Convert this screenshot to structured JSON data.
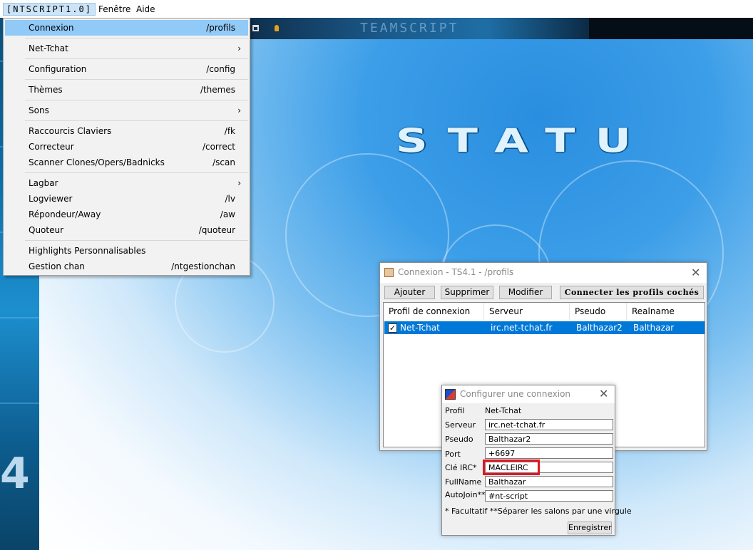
{
  "menubar": {
    "items": [
      {
        "label": "[NTSCRIPT1.0]"
      },
      {
        "label": "Fenêtre"
      },
      {
        "label": "Aide"
      }
    ]
  },
  "banner": {
    "title": "TEAMSCRIPT"
  },
  "logo": {
    "text": "STATU"
  },
  "left_deco": {
    "text": "4"
  },
  "dropdown": {
    "items": [
      {
        "label": "Connexion",
        "shortcut": "/profils",
        "active": true
      },
      {
        "label": "Net-Tchat",
        "submenu": true
      },
      {
        "label": "Configuration",
        "shortcut": "/config"
      },
      {
        "label": "Thèmes",
        "shortcut": "/themes"
      },
      {
        "label": "Sons",
        "submenu": true
      },
      {
        "label": "Raccourcis Claviers",
        "shortcut": "/fk"
      },
      {
        "label": "Correcteur",
        "shortcut": "/correct"
      },
      {
        "label": "Scanner Clones/Opers/Badnicks",
        "shortcut": "/scan"
      },
      {
        "label": "Lagbar",
        "submenu": true
      },
      {
        "label": "Logviewer",
        "shortcut": "/lv"
      },
      {
        "label": "Répondeur/Away",
        "shortcut": "/aw"
      },
      {
        "label": "Quoteur",
        "shortcut": "/quoteur"
      },
      {
        "label": "Highlights Personnalisables",
        "shortcut": ""
      },
      {
        "label": "Gestion chan",
        "shortcut": "/ntgestionchan"
      }
    ],
    "arrow": "›"
  },
  "connexion_window": {
    "title": "Connexion - TS4.1 - /profils",
    "close": "✕",
    "buttons": {
      "ajouter": "Ajouter",
      "supprimer": "Supprimer",
      "modifier": "Modifier",
      "connecter": "Connecter les profils cochés"
    },
    "columns": [
      "Profil de connexion",
      "Serveur",
      "Pseudo",
      "Realname"
    ],
    "rows": [
      {
        "checked": "✓",
        "profil": "Net-Tchat",
        "serveur": "irc.net-tchat.fr",
        "pseudo": "Balthazar2",
        "realname": "Balthazar"
      }
    ]
  },
  "config_window": {
    "title": "Configurer une connexion",
    "close": "✕",
    "profil_label": "Profil",
    "profil_value": "Net-Tchat",
    "fields": {
      "serveur": {
        "label": "Serveur",
        "value": "irc.net-tchat.fr"
      },
      "pseudo": {
        "label": "Pseudo",
        "value": "Balthazar2"
      },
      "port": {
        "label": "Port",
        "value": "+6697"
      },
      "cle": {
        "label": "Clé IRC*",
        "value": "MACLEIRC"
      },
      "fullname": {
        "label": "FullName",
        "value": "Balthazar"
      },
      "autojoin": {
        "label": "AutoJoin**",
        "value": "#nt-script"
      }
    },
    "note": "* Facultatif **Séparer les salons par une virgule",
    "save": "Enregistrer"
  },
  "colors": {
    "selection": "#0078d7",
    "menu_highlight": "#91c9f7",
    "annotation_red": "#e3141f"
  }
}
